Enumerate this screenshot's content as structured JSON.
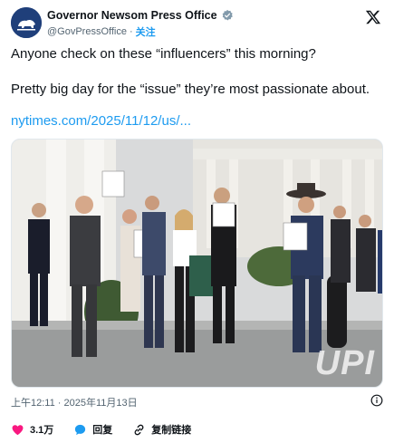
{
  "account": {
    "display_name": "Governor Newsom Press Office",
    "handle": "@GovPressOffice",
    "separator": "·",
    "follow_label": "关注"
  },
  "tweet": {
    "line1": "Anyone check on these “influencers” this morning?",
    "line2": "Pretty big day for the “issue” they’re most passionate about.",
    "link": "nytimes.com/2025/11/12/us/..."
  },
  "photo": {
    "watermark": "UPI"
  },
  "meta": {
    "timestamp": "上午12:11 · 2025年11月13日"
  },
  "actions": {
    "like_count": "3.1万",
    "reply_label": "回复",
    "copy_label": "复制链接"
  },
  "colors": {
    "accent": "#1d9bf0",
    "like": "#f91880",
    "verified": "#829aab"
  }
}
